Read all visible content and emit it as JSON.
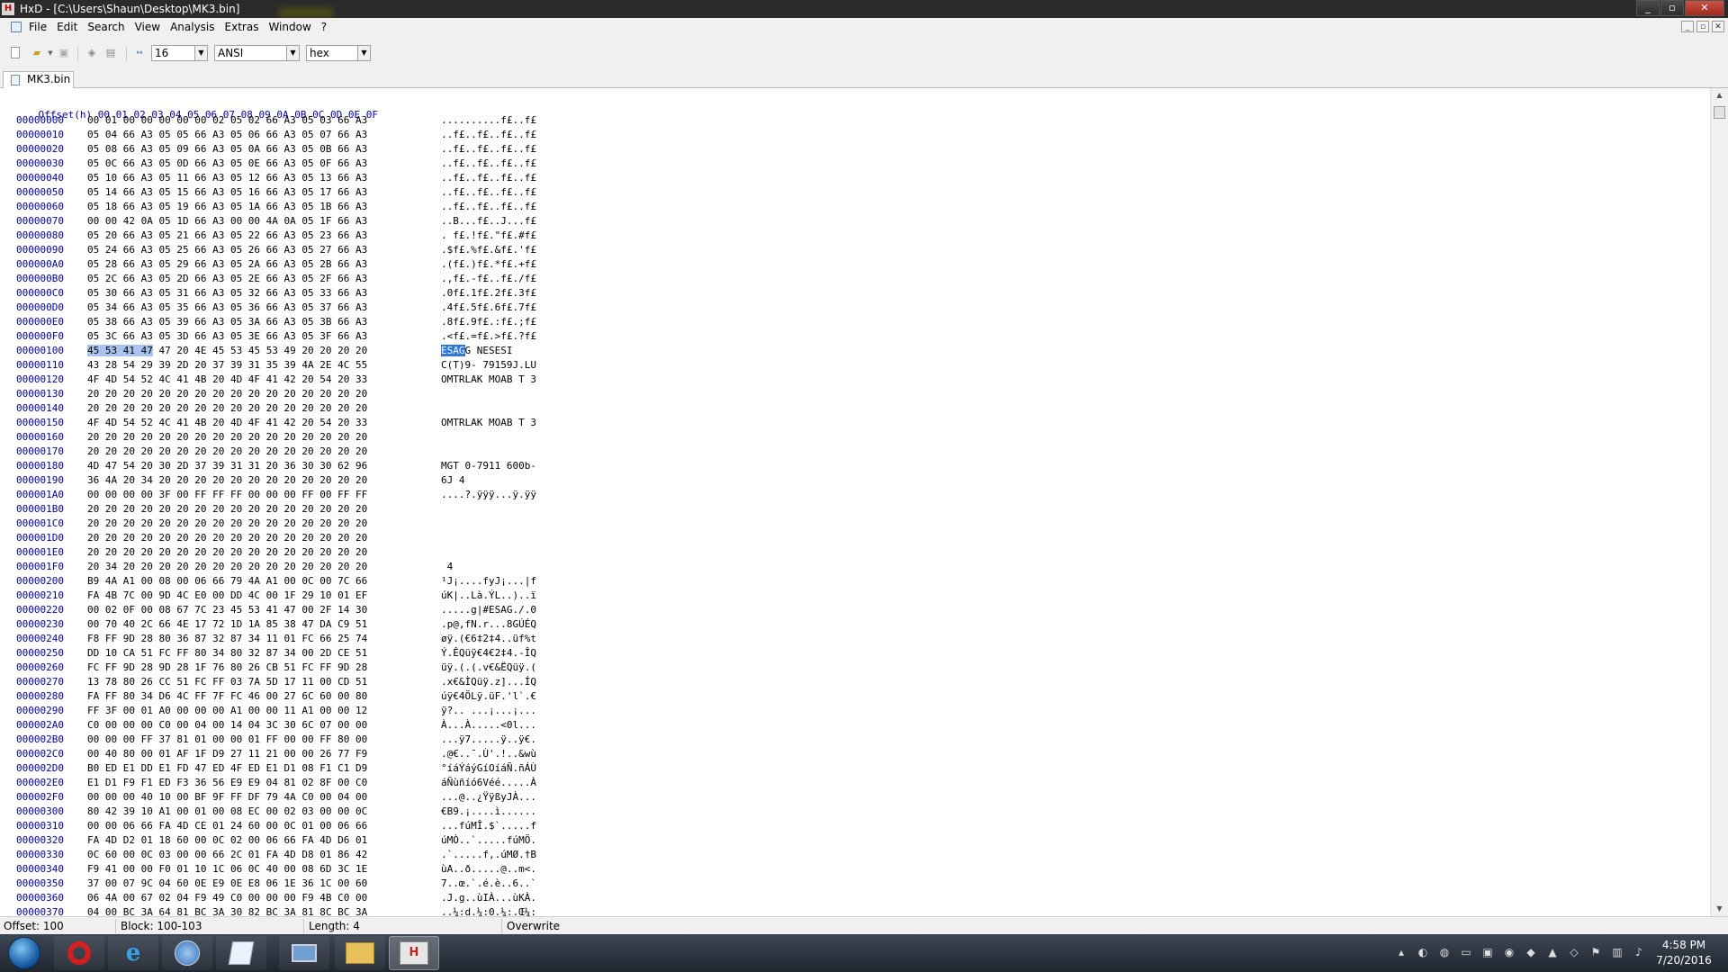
{
  "window": {
    "title": "HxD - [C:\\Users\\Shaun\\Desktop\\MK3.bin]",
    "app_icon": "hxd-icon",
    "controls": [
      "_",
      "▫",
      "✕"
    ]
  },
  "menu": [
    "File",
    "Edit",
    "Search",
    "View",
    "Analysis",
    "Extras",
    "Window",
    "?"
  ],
  "mdi_controls": [
    "_",
    "▫",
    "✕"
  ],
  "toolbar": {
    "bytes_per_row": "16",
    "charset": "ANSI",
    "offset_base": "hex",
    "icons": [
      "new-file-icon",
      "open-file-icon",
      "save-icon",
      "disk-icon",
      "print-icon",
      "columns-icon"
    ]
  },
  "tab": {
    "label": "MK3.bin"
  },
  "header": "Offset(h) 00 01 02 03 04 05 06 07 08 09 0A 0B 0C 0D 0E 0F",
  "rows": [
    {
      "o": "00000000",
      "h": "00 01 00 00 00 00 00 02 05 02 66 A3 05 03 66 A3",
      "a": "..........f£..f£"
    },
    {
      "o": "00000010",
      "h": "05 04 66 A3 05 05 66 A3 05 06 66 A3 05 07 66 A3",
      "a": "..f£..f£..f£..f£"
    },
    {
      "o": "00000020",
      "h": "05 08 66 A3 05 09 66 A3 05 0A 66 A3 05 0B 66 A3",
      "a": "..f£..f£..f£..f£"
    },
    {
      "o": "00000030",
      "h": "05 0C 66 A3 05 0D 66 A3 05 0E 66 A3 05 0F 66 A3",
      "a": "..f£..f£..f£..f£"
    },
    {
      "o": "00000040",
      "h": "05 10 66 A3 05 11 66 A3 05 12 66 A3 05 13 66 A3",
      "a": "..f£..f£..f£..f£"
    },
    {
      "o": "00000050",
      "h": "05 14 66 A3 05 15 66 A3 05 16 66 A3 05 17 66 A3",
      "a": "..f£..f£..f£..f£"
    },
    {
      "o": "00000060",
      "h": "05 18 66 A3 05 19 66 A3 05 1A 66 A3 05 1B 66 A3",
      "a": "..f£..f£..f£..f£"
    },
    {
      "o": "00000070",
      "h": "00 00 42 0A 05 1D 66 A3 00 00 4A 0A 05 1F 66 A3",
      "a": "..B...f£..J...f£"
    },
    {
      "o": "00000080",
      "h": "05 20 66 A3 05 21 66 A3 05 22 66 A3 05 23 66 A3",
      "a": ". f£.!f£.\"f£.#f£"
    },
    {
      "o": "00000090",
      "h": "05 24 66 A3 05 25 66 A3 05 26 66 A3 05 27 66 A3",
      "a": ".$f£.%f£.&f£.'f£"
    },
    {
      "o": "000000A0",
      "h": "05 28 66 A3 05 29 66 A3 05 2A 66 A3 05 2B 66 A3",
      "a": ".(f£.)f£.*f£.+f£"
    },
    {
      "o": "000000B0",
      "h": "05 2C 66 A3 05 2D 66 A3 05 2E 66 A3 05 2F 66 A3",
      "a": ".,f£.-f£..f£./f£"
    },
    {
      "o": "000000C0",
      "h": "05 30 66 A3 05 31 66 A3 05 32 66 A3 05 33 66 A3",
      "a": ".0f£.1f£.2f£.3f£"
    },
    {
      "o": "000000D0",
      "h": "05 34 66 A3 05 35 66 A3 05 36 66 A3 05 37 66 A3",
      "a": ".4f£.5f£.6f£.7f£"
    },
    {
      "o": "000000E0",
      "h": "05 38 66 A3 05 39 66 A3 05 3A 66 A3 05 3B 66 A3",
      "a": ".8f£.9f£.:f£.;f£"
    },
    {
      "o": "000000F0",
      "h": "05 3C 66 A3 05 3D 66 A3 05 3E 66 A3 05 3F 66 A3",
      "a": ".<f£.=f£.>f£.?f£"
    },
    {
      "o": "00000100",
      "hs": "45 53 41 47",
      "h": " 47 20 4E 45 53 45 53 49 20 20 20 20",
      "as": "ESAG",
      "a": "G NESESI    "
    },
    {
      "o": "00000110",
      "h": "43 28 54 29 39 2D 20 37 39 31 35 39 4A 2E 4C 55",
      "a": "C(T)9- 79159J.LU"
    },
    {
      "o": "00000120",
      "h": "4F 4D 54 52 4C 41 4B 20 4D 4F 41 42 20 54 20 33",
      "a": "OMTRLAK MOAB T 3"
    },
    {
      "o": "00000130",
      "h": "20 20 20 20 20 20 20 20 20 20 20 20 20 20 20 20",
      "a": ""
    },
    {
      "o": "00000140",
      "h": "20 20 20 20 20 20 20 20 20 20 20 20 20 20 20 20",
      "a": ""
    },
    {
      "o": "00000150",
      "h": "4F 4D 54 52 4C 41 4B 20 4D 4F 41 42 20 54 20 33",
      "a": "OMTRLAK MOAB T 3"
    },
    {
      "o": "00000160",
      "h": "20 20 20 20 20 20 20 20 20 20 20 20 20 20 20 20",
      "a": ""
    },
    {
      "o": "00000170",
      "h": "20 20 20 20 20 20 20 20 20 20 20 20 20 20 20 20",
      "a": ""
    },
    {
      "o": "00000180",
      "h": "4D 47 54 20 30 2D 37 39 31 31 20 36 30 30 62 96",
      "a": "MGT 0-7911 600b-"
    },
    {
      "o": "00000190",
      "h": "36 4A 20 34 20 20 20 20 20 20 20 20 20 20 20 20",
      "a": "6J 4"
    },
    {
      "o": "000001A0",
      "h": "00 00 00 00 3F 00 FF FF FF 00 00 00 FF 00 FF FF",
      "a": "....?.ÿÿÿ...ÿ.ÿÿ"
    },
    {
      "o": "000001B0",
      "h": "20 20 20 20 20 20 20 20 20 20 20 20 20 20 20 20",
      "a": ""
    },
    {
      "o": "000001C0",
      "h": "20 20 20 20 20 20 20 20 20 20 20 20 20 20 20 20",
      "a": ""
    },
    {
      "o": "000001D0",
      "h": "20 20 20 20 20 20 20 20 20 20 20 20 20 20 20 20",
      "a": ""
    },
    {
      "o": "000001E0",
      "h": "20 20 20 20 20 20 20 20 20 20 20 20 20 20 20 20",
      "a": ""
    },
    {
      "o": "000001F0",
      "h": "20 34 20 20 20 20 20 20 20 20 20 20 20 20 20 20",
      "a": " 4"
    },
    {
      "o": "00000200",
      "h": "B9 4A A1 00 08 00 06 66 79 4A A1 00 0C 00 7C 66",
      "a": "¹J¡....fyJ¡...|f"
    },
    {
      "o": "00000210",
      "h": "FA 4B 7C 00 9D 4C E0 00 DD 4C 00 1F 29 10 01 EF",
      "a": "úK|..Là.ÝL..)..ï"
    },
    {
      "o": "00000220",
      "h": "00 02 0F 00 08 67 7C 23 45 53 41 47 00 2F 14 30",
      "a": ".....g|#ESAG./.0"
    },
    {
      "o": "00000230",
      "h": "00 70 40 2C 66 4E 17 72 1D 1A 85 38 47 DA C9 51",
      "a": ".p@,fN.r...8GÚÉQ"
    },
    {
      "o": "00000240",
      "h": "F8 FF 9D 28 80 36 87 32 87 34 11 01 FC 66 25 74",
      "a": "øÿ.(€6‡2‡4..üf%t"
    },
    {
      "o": "00000250",
      "h": "DD 10 CA 51 FC FF 80 34 80 32 87 34 00 2D CE 51",
      "a": "Ý.ÊQüÿ€4€2‡4.-ÎQ"
    },
    {
      "o": "00000260",
      "h": "FC FF 9D 28 9D 28 1F 76 80 26 CB 51 FC FF 9D 28",
      "a": "üÿ.(.(.v€&ËQüÿ.("
    },
    {
      "o": "00000270",
      "h": "13 78 80 26 CC 51 FC FF 03 7A 5D 17 11 00 CD 51",
      "a": ".x€&ÌQüÿ.z]...ÍQ"
    },
    {
      "o": "00000280",
      "h": "FA FF 80 34 D6 4C FF 7F FC 46 00 27 6C 60 00 80",
      "a": "úÿ€4ÖLÿ.üF.'l`.€"
    },
    {
      "o": "00000290",
      "h": "FF 3F 00 01 A0 00 00 00 A1 00 00 11 A1 00 00 12",
      "a": "ÿ?.. ...¡...¡..."
    },
    {
      "o": "000002A0",
      "h": "C0 00 00 00 C0 00 04 00 14 04 3C 30 6C 07 00 00",
      "a": "À...À.....<0l..."
    },
    {
      "o": "000002B0",
      "h": "00 00 00 FF 37 81 01 00 00 01 FF 00 00 FF 80 00",
      "a": "...ÿ7.....ÿ..ÿ€."
    },
    {
      "o": "000002C0",
      "h": "00 40 80 00 01 AF 1F D9 27 11 21 00 00 26 77 F9",
      "a": ".@€..¯.Ù'.!..&wù"
    },
    {
      "o": "000002D0",
      "h": "B0 ED E1 DD E1 FD 47 ED 4F ED E1 D1 08 F1 C1 D9",
      "a": "°íáÝáýGíOíáÑ.ñÁÙ"
    },
    {
      "o": "000002E0",
      "h": "E1 D1 F9 F1 ED F3 36 56 E9 E9 04 81 02 8F 00 C0",
      "a": "áÑùñíó6Véé.....À"
    },
    {
      "o": "000002F0",
      "h": "00 00 00 40 10 00 BF 9F FF DF 79 4A C0 00 04 00",
      "a": "...@..¿ŸÿßyJÀ..."
    },
    {
      "o": "00000300",
      "h": "80 42 39 10 A1 00 01 00 08 EC 00 02 03 00 00 0C",
      "a": "€B9.¡....ì......"
    },
    {
      "o": "00000310",
      "h": "00 00 06 66 FA 4D CE 01 24 60 00 0C 01 00 06 66",
      "a": "...fúMÎ.$`.....f"
    },
    {
      "o": "00000320",
      "h": "FA 4D D2 01 18 60 00 0C 02 00 06 66 FA 4D D6 01",
      "a": "úMÒ..`.....fúMÖ."
    },
    {
      "o": "00000330",
      "h": "0C 60 00 0C 03 00 00 66 2C 01 FA 4D D8 01 86 42",
      "a": ".`.....f,.úMØ.†B"
    },
    {
      "o": "00000340",
      "h": "F9 41 00 00 F0 01 10 1C 06 0C 40 00 08 6D 3C 1E",
      "a": "ùA..ð.....@..m<."
    },
    {
      "o": "00000350",
      "h": "37 00 07 9C 04 60 0E E9 0E E8 06 1E 36 1C 00 60",
      "a": "7..œ.`.é.è..6..`"
    },
    {
      "o": "00000360",
      "h": "06 4A 00 67 02 04 F9 49 C0 00 00 00 F9 4B C0 00",
      "a": ".J.g..ùIÀ...ùKÀ."
    },
    {
      "o": "00000370",
      "h": "04 00 BC 3A 64 81 BC 3A 30 82 BC 3A 81 8C BC 3A",
      "a": "..¼:d.¼:0.¼:.Œ¼:"
    }
  ],
  "status": {
    "offset": "Offset: 100",
    "block": "Block: 100-103",
    "length": "Length: 4",
    "mode": "Overwrite"
  },
  "taskbar": {
    "apps": [
      "start-orb",
      "opera-icon",
      "internet-explorer-icon",
      "app-circle-icon",
      "notepad-icon",
      "computer-icon",
      "folder-icon",
      "hxd-icon"
    ],
    "clock_time": "4:58 PM",
    "clock_date": "7/20/2016"
  }
}
